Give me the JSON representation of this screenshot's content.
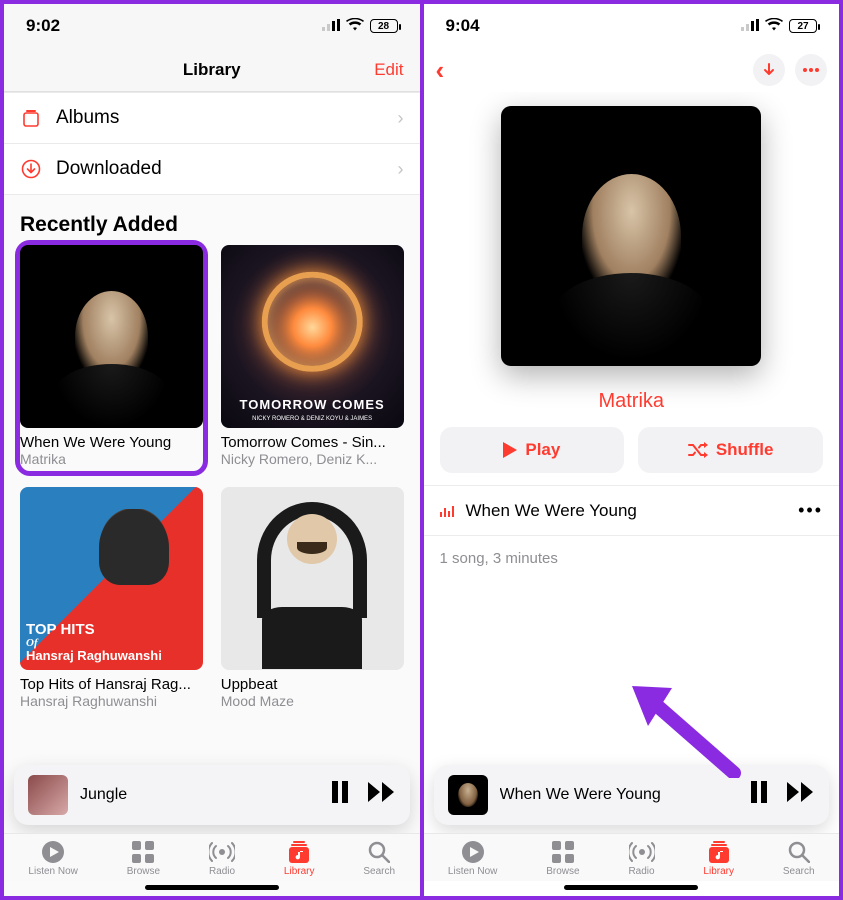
{
  "left": {
    "status": {
      "time": "9:02",
      "battery": "28"
    },
    "header": {
      "title": "Library",
      "edit": "Edit"
    },
    "rows": {
      "albums": "Albums",
      "downloaded": "Downloaded"
    },
    "section_title": "Recently Added",
    "albums": [
      {
        "title": "When We Were Young",
        "artist": "Matrika"
      },
      {
        "title": "Tomorrow Comes - Sin...",
        "artist": "Nicky Romero, Deniz K..."
      },
      {
        "title": "Top Hits of Hansraj Rag...",
        "artist": "Hansraj Raghuwanshi"
      },
      {
        "title": "Uppbeat",
        "artist": "Mood Maze"
      }
    ],
    "art_text": {
      "tomorrow_line1": "TOMORROW COMES",
      "tomorrow_line2": "NICKY ROMERO & DENIZ KOYU & JAIMES",
      "tophits_l1": "TOP HITS",
      "tophits_l2": "Of",
      "tophits_l3": "Hansraj Raghuwanshi"
    },
    "mini": {
      "title": "Jungle"
    }
  },
  "right": {
    "status": {
      "time": "9:04",
      "battery": "27"
    },
    "artist": "Matrika",
    "buttons": {
      "play": "Play",
      "shuffle": "Shuffle"
    },
    "track": "When We Were Young",
    "meta": "1 song, 3 minutes",
    "mini": {
      "title": "When We Were Young"
    }
  },
  "tabs": {
    "listen": "Listen Now",
    "browse": "Browse",
    "radio": "Radio",
    "library": "Library",
    "search": "Search"
  }
}
